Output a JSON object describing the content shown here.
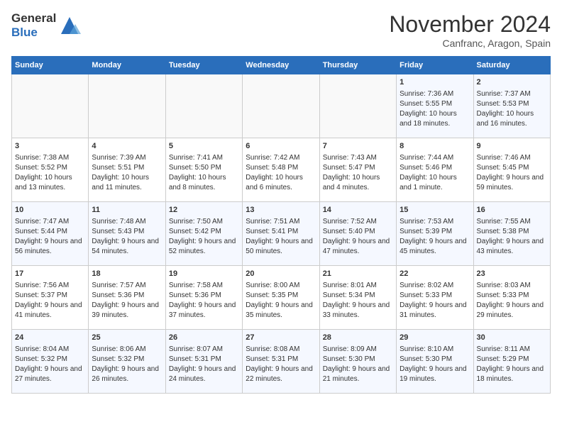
{
  "header": {
    "logo_line1": "General",
    "logo_line2": "Blue",
    "month": "November 2024",
    "location": "Canfranc, Aragon, Spain"
  },
  "weekdays": [
    "Sunday",
    "Monday",
    "Tuesday",
    "Wednesday",
    "Thursday",
    "Friday",
    "Saturday"
  ],
  "weeks": [
    [
      {
        "day": "",
        "text": ""
      },
      {
        "day": "",
        "text": ""
      },
      {
        "day": "",
        "text": ""
      },
      {
        "day": "",
        "text": ""
      },
      {
        "day": "",
        "text": ""
      },
      {
        "day": "1",
        "text": "Sunrise: 7:36 AM\nSunset: 5:55 PM\nDaylight: 10 hours and 18 minutes."
      },
      {
        "day": "2",
        "text": "Sunrise: 7:37 AM\nSunset: 5:53 PM\nDaylight: 10 hours and 16 minutes."
      }
    ],
    [
      {
        "day": "3",
        "text": "Sunrise: 7:38 AM\nSunset: 5:52 PM\nDaylight: 10 hours and 13 minutes."
      },
      {
        "day": "4",
        "text": "Sunrise: 7:39 AM\nSunset: 5:51 PM\nDaylight: 10 hours and 11 minutes."
      },
      {
        "day": "5",
        "text": "Sunrise: 7:41 AM\nSunset: 5:50 PM\nDaylight: 10 hours and 8 minutes."
      },
      {
        "day": "6",
        "text": "Sunrise: 7:42 AM\nSunset: 5:48 PM\nDaylight: 10 hours and 6 minutes."
      },
      {
        "day": "7",
        "text": "Sunrise: 7:43 AM\nSunset: 5:47 PM\nDaylight: 10 hours and 4 minutes."
      },
      {
        "day": "8",
        "text": "Sunrise: 7:44 AM\nSunset: 5:46 PM\nDaylight: 10 hours and 1 minute."
      },
      {
        "day": "9",
        "text": "Sunrise: 7:46 AM\nSunset: 5:45 PM\nDaylight: 9 hours and 59 minutes."
      }
    ],
    [
      {
        "day": "10",
        "text": "Sunrise: 7:47 AM\nSunset: 5:44 PM\nDaylight: 9 hours and 56 minutes."
      },
      {
        "day": "11",
        "text": "Sunrise: 7:48 AM\nSunset: 5:43 PM\nDaylight: 9 hours and 54 minutes."
      },
      {
        "day": "12",
        "text": "Sunrise: 7:50 AM\nSunset: 5:42 PM\nDaylight: 9 hours and 52 minutes."
      },
      {
        "day": "13",
        "text": "Sunrise: 7:51 AM\nSunset: 5:41 PM\nDaylight: 9 hours and 50 minutes."
      },
      {
        "day": "14",
        "text": "Sunrise: 7:52 AM\nSunset: 5:40 PM\nDaylight: 9 hours and 47 minutes."
      },
      {
        "day": "15",
        "text": "Sunrise: 7:53 AM\nSunset: 5:39 PM\nDaylight: 9 hours and 45 minutes."
      },
      {
        "day": "16",
        "text": "Sunrise: 7:55 AM\nSunset: 5:38 PM\nDaylight: 9 hours and 43 minutes."
      }
    ],
    [
      {
        "day": "17",
        "text": "Sunrise: 7:56 AM\nSunset: 5:37 PM\nDaylight: 9 hours and 41 minutes."
      },
      {
        "day": "18",
        "text": "Sunrise: 7:57 AM\nSunset: 5:36 PM\nDaylight: 9 hours and 39 minutes."
      },
      {
        "day": "19",
        "text": "Sunrise: 7:58 AM\nSunset: 5:36 PM\nDaylight: 9 hours and 37 minutes."
      },
      {
        "day": "20",
        "text": "Sunrise: 8:00 AM\nSunset: 5:35 PM\nDaylight: 9 hours and 35 minutes."
      },
      {
        "day": "21",
        "text": "Sunrise: 8:01 AM\nSunset: 5:34 PM\nDaylight: 9 hours and 33 minutes."
      },
      {
        "day": "22",
        "text": "Sunrise: 8:02 AM\nSunset: 5:33 PM\nDaylight: 9 hours and 31 minutes."
      },
      {
        "day": "23",
        "text": "Sunrise: 8:03 AM\nSunset: 5:33 PM\nDaylight: 9 hours and 29 minutes."
      }
    ],
    [
      {
        "day": "24",
        "text": "Sunrise: 8:04 AM\nSunset: 5:32 PM\nDaylight: 9 hours and 27 minutes."
      },
      {
        "day": "25",
        "text": "Sunrise: 8:06 AM\nSunset: 5:32 PM\nDaylight: 9 hours and 26 minutes."
      },
      {
        "day": "26",
        "text": "Sunrise: 8:07 AM\nSunset: 5:31 PM\nDaylight: 9 hours and 24 minutes."
      },
      {
        "day": "27",
        "text": "Sunrise: 8:08 AM\nSunset: 5:31 PM\nDaylight: 9 hours and 22 minutes."
      },
      {
        "day": "28",
        "text": "Sunrise: 8:09 AM\nSunset: 5:30 PM\nDaylight: 9 hours and 21 minutes."
      },
      {
        "day": "29",
        "text": "Sunrise: 8:10 AM\nSunset: 5:30 PM\nDaylight: 9 hours and 19 minutes."
      },
      {
        "day": "30",
        "text": "Sunrise: 8:11 AM\nSunset: 5:29 PM\nDaylight: 9 hours and 18 minutes."
      }
    ]
  ]
}
